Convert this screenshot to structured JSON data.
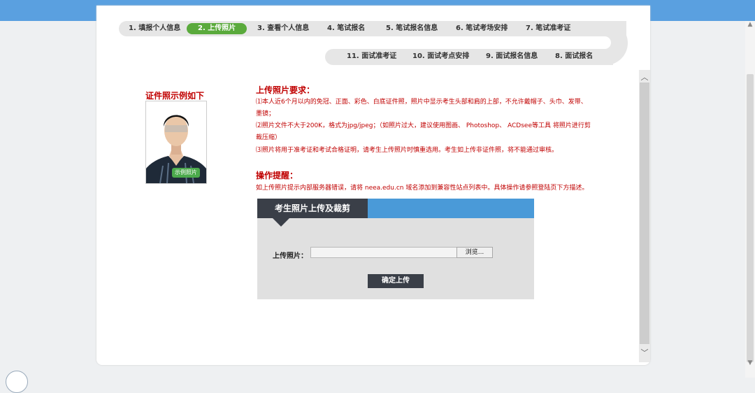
{
  "steps_row1": [
    {
      "label": "1. 填报个人信息",
      "active": false
    },
    {
      "label": "2. 上传照片",
      "active": true
    },
    {
      "label": "3. 查看个人信息",
      "active": false
    },
    {
      "label": "4. 笔试报名",
      "active": false
    },
    {
      "label": "5. 笔试报名信息",
      "active": false
    },
    {
      "label": "6. 笔试考场安排",
      "active": false
    },
    {
      "label": "7. 笔试准考证",
      "active": false
    }
  ],
  "steps_row2": [
    {
      "label": "11. 面试准考证"
    },
    {
      "label": "10. 面试考点安排"
    },
    {
      "label": "9. 面试报名信息"
    },
    {
      "label": "8. 面试报名"
    }
  ],
  "example": {
    "title": "证件照示例如下",
    "badge": "示例照片"
  },
  "requirements": {
    "title": "上传照片要求：",
    "lines": [
      "⑴本人近6个月以内的免冠、正面、彩色、白底证件照，照片中显示考生头部和肩的上部，不允许戴帽子、头巾、发带、",
      "墨镜；",
      "⑵照片文件不大于200K，格式为jpg/jpeg；（如照片过大，建议使用图画、 Photoshop、 ACDsee等工具 将照片进行剪",
      "裁压缩）",
      "⑶照片将用于准考证和考试合格证明，请考生上传照片时慎重选用。考生如上传非证件照，将不能通过审核。"
    ]
  },
  "tip": {
    "title": "操作提醒：",
    "text": "如上传照片提示内部服务器错误，请将 neea.edu.cn 域名添加到兼容性站点列表中。具体操作请参照登陆页下方描述。"
  },
  "upload": {
    "header": "考生照片上传及裁剪",
    "label": "上传照片：",
    "file_value": "",
    "browse": "浏览...",
    "confirm": "确定上传"
  },
  "colors": {
    "accent_green": "#5aaa3c",
    "warning_red": "#c00000",
    "header_dark": "#3a3f48",
    "header_blue": "#4a9ad8"
  }
}
